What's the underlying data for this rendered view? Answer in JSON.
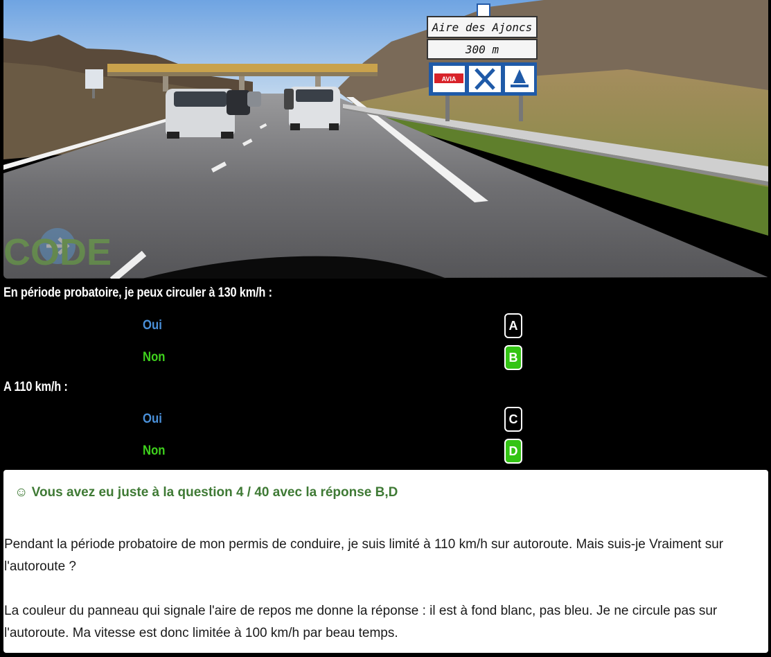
{
  "photo": {
    "sign_name": "Aire des Ajoncs",
    "sign_distance": "300 m",
    "sign_brand": "AVIA",
    "watermark": "CODE"
  },
  "questions": [
    {
      "label": "En période probatoire, je peux circuler à 130 km/h :",
      "options": [
        {
          "text": "Oui",
          "key": "A",
          "selected": false
        },
        {
          "text": "Non",
          "key": "B",
          "selected": true
        }
      ]
    },
    {
      "label": "A 110 km/h :",
      "options": [
        {
          "text": "Oui",
          "key": "C",
          "selected": false
        },
        {
          "text": "Non",
          "key": "D",
          "selected": true
        }
      ]
    }
  ],
  "feedback": {
    "result": "☺ Vous avez eu juste à la question 4 / 40 avec la réponse B,D",
    "paragraph1": "Pendant la période probatoire de mon permis de conduire, je suis limité à 110 km/h sur autoroute. Mais suis-je Vraiment sur l'autoroute ?",
    "paragraph2": "La couleur du panneau qui signale l'aire de repos me donne la réponse : il est à fond blanc, pas bleu. Je ne circule pas sur l'autoroute. Ma vitesse est donc limitée à 100 km/h par beau temps."
  },
  "colors": {
    "oui": "#4a90d9",
    "non": "#3fd11d",
    "selected_key": "#33c414",
    "result_text": "#3f7a35"
  }
}
